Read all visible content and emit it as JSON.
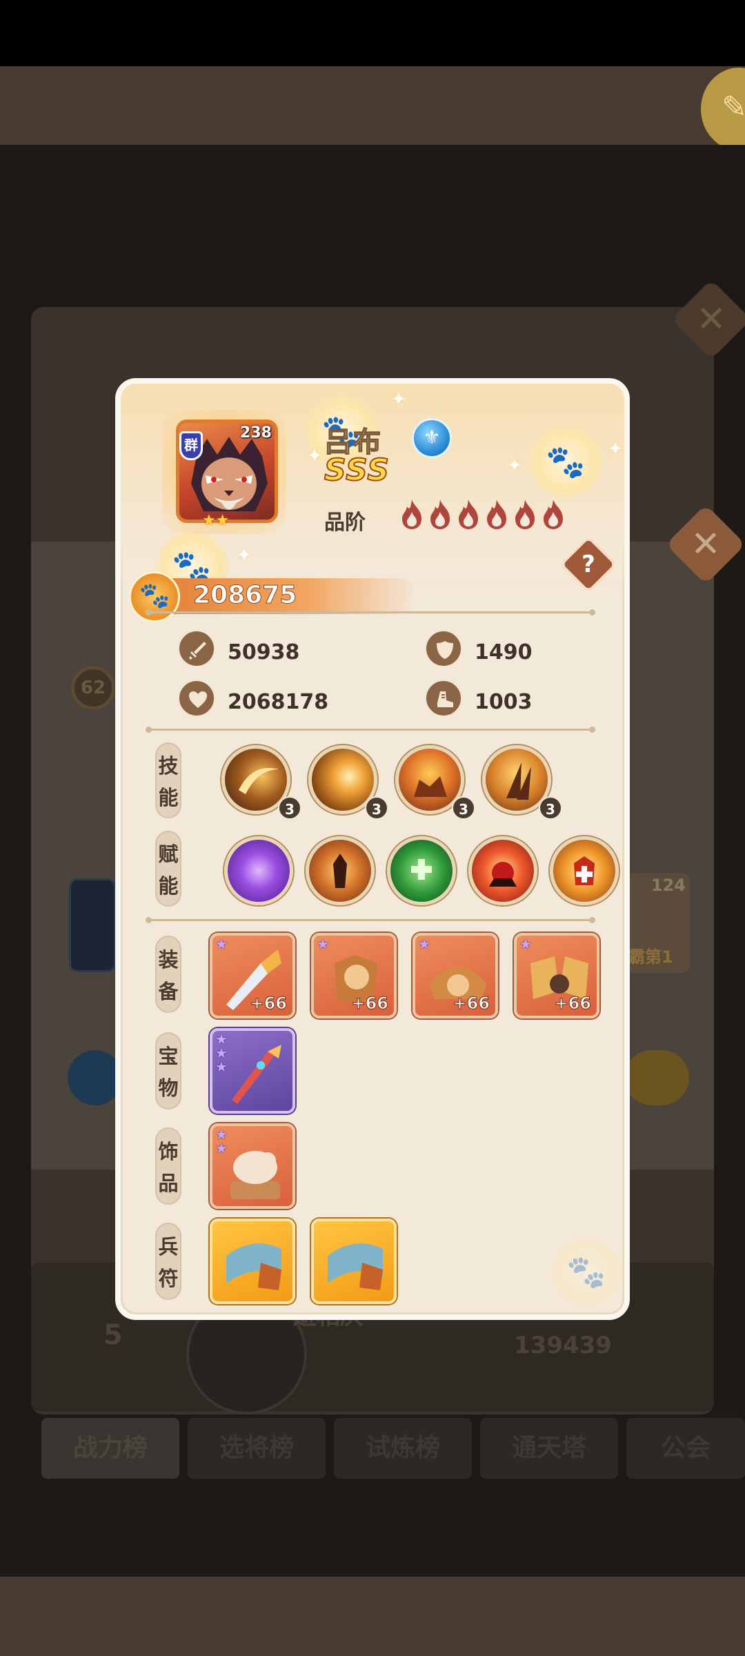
{
  "hero": {
    "name": "吕布",
    "grade": "SSS",
    "level": "238",
    "faction": "群",
    "rank_label": "品阶",
    "rank_flames": 6,
    "power": "208675"
  },
  "stats": {
    "attack": "50938",
    "defense": "1490",
    "hp": "2068178",
    "speed": "1003"
  },
  "labels": {
    "skills": [
      "技",
      "能"
    ],
    "talents": [
      "赋",
      "能"
    ],
    "equipment": [
      "装",
      "备"
    ],
    "treasure": [
      "宝",
      "物"
    ],
    "ornament": [
      "饰",
      "品"
    ],
    "token": [
      "兵",
      "符"
    ]
  },
  "skills": [
    {
      "level": "3",
      "icon": "crescent-slash-icon"
    },
    {
      "level": "3",
      "icon": "sun-burst-icon"
    },
    {
      "level": "3",
      "icon": "flame-beast-icon"
    },
    {
      "level": "3",
      "icon": "claw-strike-icon"
    }
  ],
  "talents": [
    {
      "icon": "purple-vortex-icon"
    },
    {
      "icon": "warrior-aura-icon"
    },
    {
      "icon": "green-heal-icon"
    },
    {
      "icon": "red-explosion-icon"
    },
    {
      "icon": "medic-shield-icon"
    }
  ],
  "equipment": [
    {
      "enhance": "+66",
      "icon": "blade-weapon-icon"
    },
    {
      "enhance": "+66",
      "icon": "armor-cat-icon"
    },
    {
      "enhance": "+66",
      "icon": "helmet-cat-icon"
    },
    {
      "enhance": "+66",
      "icon": "boots-cat-icon"
    }
  ],
  "treasure": [
    {
      "icon": "jeweled-sword-icon"
    }
  ],
  "ornament": [
    {
      "icon": "pig-figurine-icon"
    }
  ],
  "tokens": [
    {
      "icon": "scroll-token-icon"
    },
    {
      "icon": "scroll-token-icon"
    }
  ],
  "background": {
    "tabs": [
      "战力榜",
      "选将榜",
      "试炼榜",
      "通天塔",
      "公会"
    ],
    "rank_number": "5",
    "rank_name": "避相庆",
    "rank_score": "139439",
    "badge_level": "62",
    "card_level": "124",
    "card_rank": "霸第1"
  },
  "colors": {
    "popup_bg": "#f3e9db",
    "accent_orange": "#e27c35",
    "text_dark": "#3e3226"
  }
}
